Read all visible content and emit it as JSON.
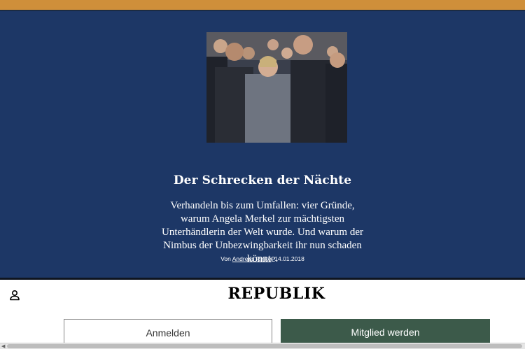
{
  "article": {
    "title": "Der Schrecken der Nächte",
    "lead": "Verhandeln bis zum Umfallen: vier Gründe, warum Angela Merkel zur mächtigsten Unterhändlerin der Welt wurde. Und warum der Nimbus der Unbezwingbarkeit ihr nun schaden könnte.",
    "byline_prefix": "Von",
    "author": "Andreas Rinke",
    "date": ", 14.01.2018"
  },
  "header": {
    "logo": "REPUBLIK",
    "account_icon": "user-icon"
  },
  "actions": {
    "login_label": "Anmelden",
    "member_label": "Mitglied werden"
  },
  "colors": {
    "accent_stripe": "#cf8f3a",
    "hero_background": "#1d3766",
    "member_button": "#3c5a4a"
  }
}
